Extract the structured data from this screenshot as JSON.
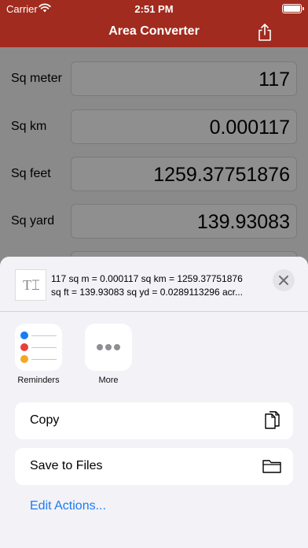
{
  "status_bar": {
    "carrier": "Carrier",
    "time": "2:51 PM"
  },
  "nav": {
    "title": "Area Converter",
    "share_icon": "share-icon"
  },
  "rows": [
    {
      "label": "Sq meter",
      "value": "117"
    },
    {
      "label": "Sq km",
      "value": "0.000117"
    },
    {
      "label": "Sq feet",
      "value": "1259.37751876"
    },
    {
      "label": "Sq yard",
      "value": "139.93083"
    }
  ],
  "share_sheet": {
    "preview_icon": "text-icon",
    "preview_line1": "117 sq m = 0.000117 sq km = 1259.37751876",
    "preview_line2": "sq ft = 139.93083 sq yd = 0.0289113296 acr...",
    "apps": [
      {
        "label": "Reminders",
        "icon": "reminders-icon"
      },
      {
        "label": "More",
        "icon": "more-icon"
      }
    ],
    "actions": [
      {
        "label": "Copy",
        "icon": "copy-icon"
      },
      {
        "label": "Save to Files",
        "icon": "folder-icon"
      }
    ],
    "edit_actions": "Edit Actions..."
  },
  "colors": {
    "nav_background": "#a12b1e",
    "sheet_background": "#f2f2f7",
    "link": "#1a7cf5",
    "reminder_dots": [
      "#1a7cf5",
      "#e8413a",
      "#f5a623"
    ]
  }
}
